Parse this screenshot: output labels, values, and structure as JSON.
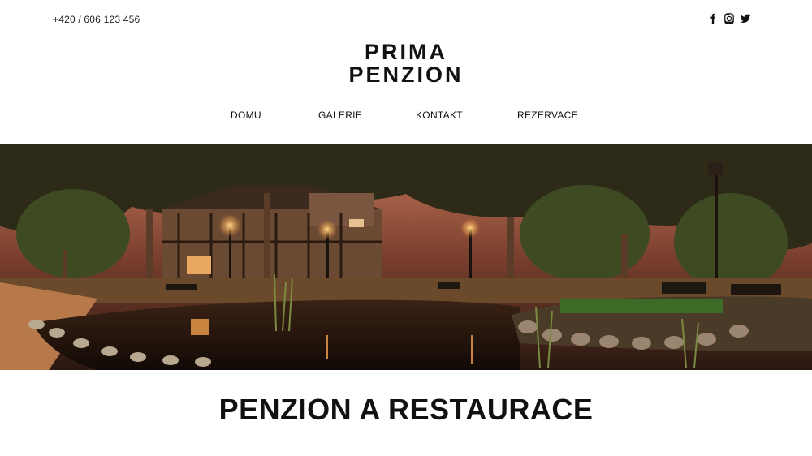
{
  "header": {
    "phone": "+420 / 606 123 456",
    "social": [
      {
        "icon": "facebook-icon"
      },
      {
        "icon": "instagram-icon"
      },
      {
        "icon": "twitter-icon"
      }
    ]
  },
  "logo": {
    "line1": "PRIMA",
    "line2": "PENZION"
  },
  "nav": {
    "items": [
      {
        "label": "DOMU"
      },
      {
        "label": "GALERIE"
      },
      {
        "label": "KONTAKT"
      },
      {
        "label": "REZERVACE"
      }
    ]
  },
  "hero": {
    "image": "night-park-with-pond-and-half-timbered-house"
  },
  "main": {
    "headline": "PENZION A RESTAURACE"
  },
  "colors": {
    "text": "#111111",
    "background": "#ffffff"
  }
}
